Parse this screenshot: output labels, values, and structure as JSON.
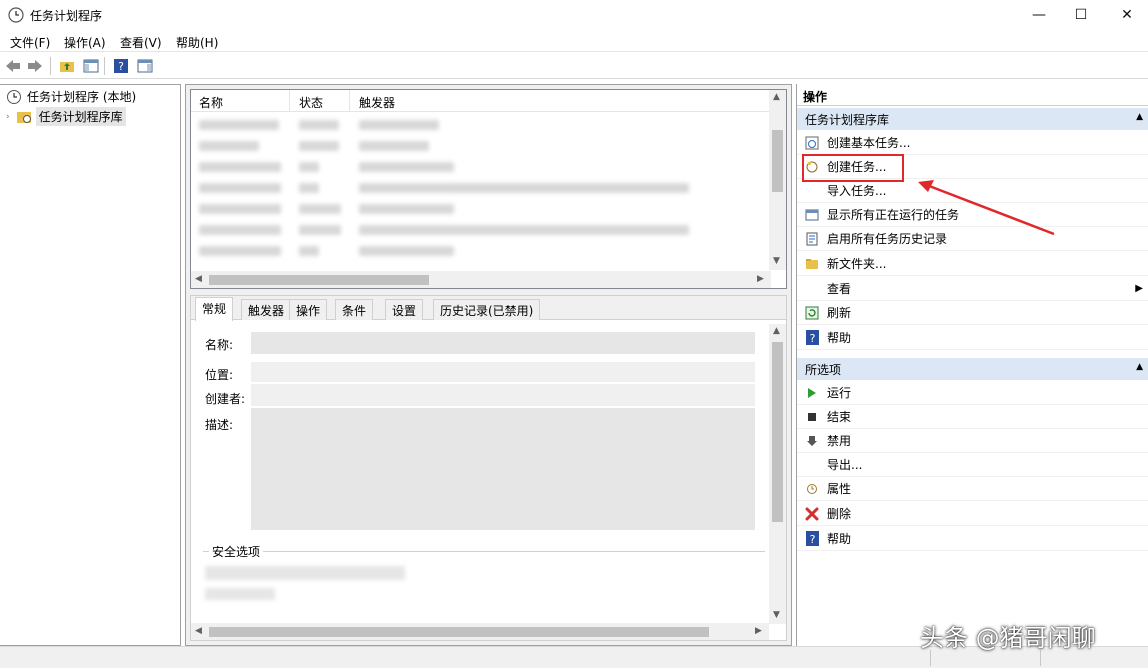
{
  "window": {
    "title": "任务计划程序",
    "min": "—",
    "max": "☐",
    "close": "✕"
  },
  "menu": [
    "文件(F)",
    "操作(A)",
    "查看(V)",
    "帮助(H)"
  ],
  "tree": {
    "root": "任务计划程序 (本地)",
    "child": "任务计划程序库"
  },
  "list": {
    "columns": [
      "名称",
      "状态",
      "触发器"
    ]
  },
  "tabs": [
    "常规",
    "触发器",
    "操作",
    "条件",
    "设置",
    "历史记录(已禁用)"
  ],
  "detail": {
    "name_label": "名称:",
    "location_label": "位置:",
    "author_label": "创建者:",
    "desc_label": "描述:",
    "security_title": "安全选项"
  },
  "actions": {
    "title": "操作",
    "section1": "任务计划程序库",
    "items1": [
      "创建基本任务...",
      "创建任务...",
      "导入任务...",
      "显示所有正在运行的任务",
      "启用所有任务历史记录",
      "新文件夹...",
      "查看",
      "刷新",
      "帮助"
    ],
    "section2": "所选项",
    "items2": [
      "运行",
      "结束",
      "禁用",
      "导出...",
      "属性",
      "删除",
      "帮助"
    ]
  },
  "colors": {
    "highlight_red": "#e0282a",
    "section_bg": "#dbe7f4"
  },
  "watermark": "头条 @猪哥闲聊"
}
